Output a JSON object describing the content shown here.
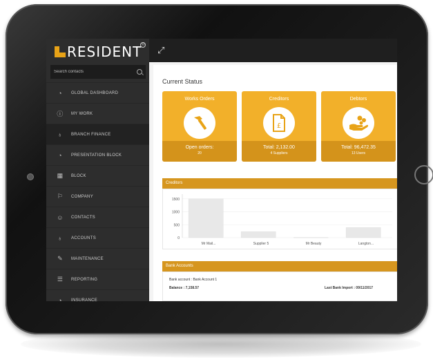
{
  "app": {
    "logo_text": "RESIDENT",
    "registered_mark": "®"
  },
  "search": {
    "placeholder": "Search contacts"
  },
  "nav": {
    "items": [
      {
        "label": "GLOBAL DASHBOARD",
        "icon": "dashboard-icon"
      },
      {
        "label": "MY WORK",
        "icon": "info-icon"
      },
      {
        "label": "BRANCH FINANCE",
        "icon": "moneybag-icon"
      },
      {
        "label": "PRESENTATION BLOCK",
        "icon": "dashboard-icon"
      },
      {
        "label": "BLOCK",
        "icon": "building-icon"
      },
      {
        "label": "COMPANY",
        "icon": "company-icon"
      },
      {
        "label": "CONTACTS",
        "icon": "contacts-icon"
      },
      {
        "label": "ACCOUNTS",
        "icon": "moneybag-icon"
      },
      {
        "label": "MAINTENANCE",
        "icon": "wrench-icon"
      },
      {
        "label": "REPORTING",
        "icon": "list-icon"
      },
      {
        "label": "INSURANCE",
        "icon": "dashboard-icon"
      }
    ],
    "active_index": 2
  },
  "main": {
    "section_title": "Current Status",
    "stats": [
      {
        "title": "Works Orders",
        "line1": "Open orders:",
        "line2": "20",
        "icon": "hammer-icon"
      },
      {
        "title": "Creditors",
        "line1": "Total: 2,132.00",
        "line2": "4 Suppliers",
        "icon": "pound-document-icon"
      },
      {
        "title": "Debtors",
        "line1": "Total: 96,472.35",
        "line2": "13 Users",
        "icon": "hand-coins-icon"
      }
    ],
    "creditors_panel": {
      "title": "Creditors"
    },
    "bank_panel": {
      "title": "Bank Accounts",
      "account_line": "Bank account : Bank Account 1",
      "balance": "Balance : 7,158.57",
      "last_import": "Last Bank Import : 09/11/2017"
    }
  },
  "chart_data": {
    "type": "bar",
    "categories": [
      "Mr Mail...",
      "Supplier 5",
      "Mr Beauty",
      "Langton..."
    ],
    "values": [
      1500,
      230,
      10,
      390
    ],
    "yticks": [
      "1500",
      "1000",
      "500",
      "0"
    ],
    "ylim": [
      0,
      1600
    ],
    "grid": true,
    "bar_color": "#e8e8e8"
  },
  "colors": {
    "accent": "#f2b02a",
    "accent_dark": "#d4931b",
    "sidebar": "#2d2d2d"
  }
}
